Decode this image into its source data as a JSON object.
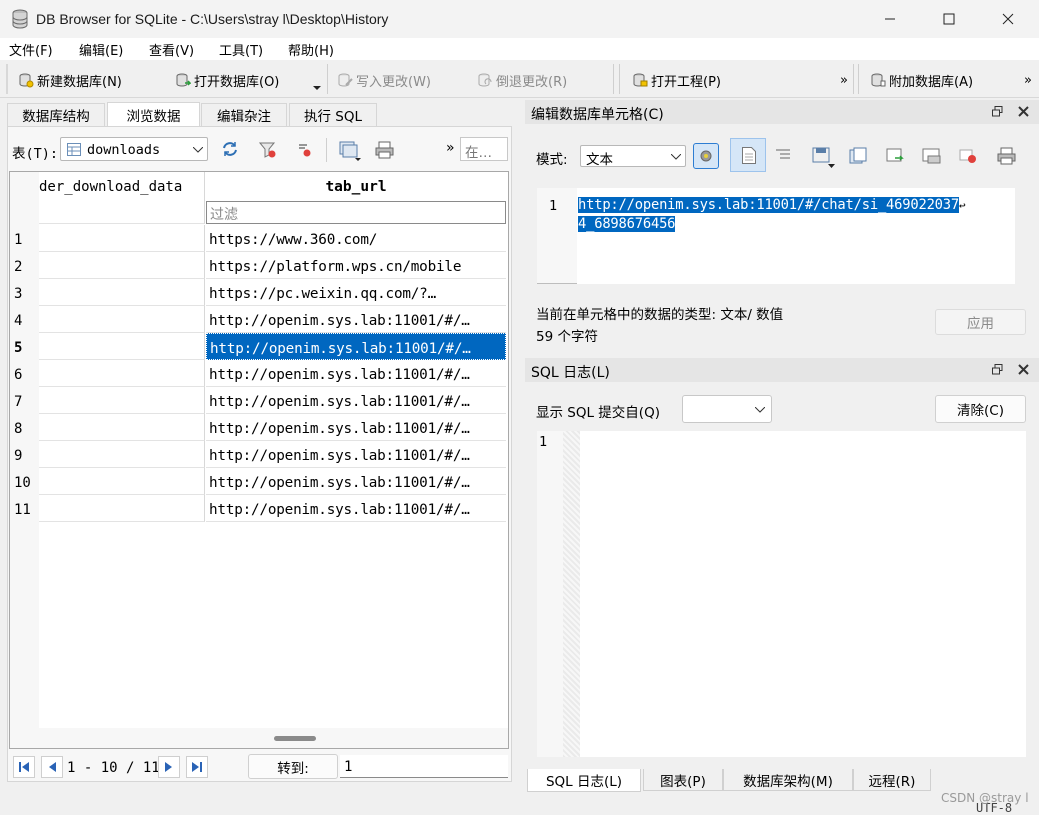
{
  "window": {
    "title": "DB Browser for SQLite - C:\\Users\\stray l\\Desktop\\History"
  },
  "menu": [
    "文件(F)",
    "编辑(E)",
    "查看(V)",
    "工具(T)",
    "帮助(H)"
  ],
  "toolbar": {
    "new_db": "新建数据库(N)",
    "open_db": "打开数据库(O)",
    "write": "写入更改(W)",
    "revert": "倒退更改(R)",
    "open_project": "打开工程(P)",
    "attach_db": "附加数据库(A)",
    "more": "»"
  },
  "tabs": [
    "数据库结构",
    "浏览数据",
    "编辑杂注",
    "执行 SQL"
  ],
  "browse": {
    "table_label": "表(T):",
    "table_value": "downloads",
    "search_placeholder": "在…",
    "columns": [
      "der_download_data",
      "tab_url"
    ],
    "filter_placeholder": "过滤",
    "rows": [
      {
        "n": "1",
        "url": "https://www.360.com/"
      },
      {
        "n": "2",
        "url": "https://platform.wps.cn/mobile"
      },
      {
        "n": "3",
        "url": "https://pc.weixin.qq.com/?…"
      },
      {
        "n": "4",
        "url": "http://openim.sys.lab:11001/#/…"
      },
      {
        "n": "5",
        "url": "http://openim.sys.lab:11001/#/…"
      },
      {
        "n": "6",
        "url": "http://openim.sys.lab:11001/#/…"
      },
      {
        "n": "7",
        "url": "http://openim.sys.lab:11001/#/…"
      },
      {
        "n": "8",
        "url": "http://openim.sys.lab:11001/#/…"
      },
      {
        "n": "9",
        "url": "http://openim.sys.lab:11001/#/…"
      },
      {
        "n": "10",
        "url": "http://openim.sys.lab:11001/#/…"
      },
      {
        "n": "11",
        "url": "http://openim.sys.lab:11001/#/…"
      }
    ],
    "selected_row": "5",
    "pager": "1 - 10 / 11",
    "goto_label": "转到:",
    "goto_value": "1"
  },
  "edit_cell": {
    "title": "编辑数据库单元格(C)",
    "mode_label": "模式:",
    "mode_value": "文本",
    "line_no": "1",
    "value_line1": "http://openim.sys.lab:11001/#/chat/si_469022037",
    "value_line2": "4_6898676456",
    "type_info": "当前在单元格中的数据的类型: 文本/ 数值",
    "char_count": "59 个字符",
    "apply": "应用"
  },
  "sql_log": {
    "title": "SQL 日志(L)",
    "show_label": "显示 SQL 提交自(Q)",
    "clear": "清除(C)",
    "line_no": "1"
  },
  "bottom_tabs": [
    "SQL 日志(L)",
    "图表(P)",
    "数据库架构(M)",
    "远程(R)"
  ],
  "status": {
    "encoding": "UTF-8",
    "watermark": "CSDN @stray l"
  }
}
